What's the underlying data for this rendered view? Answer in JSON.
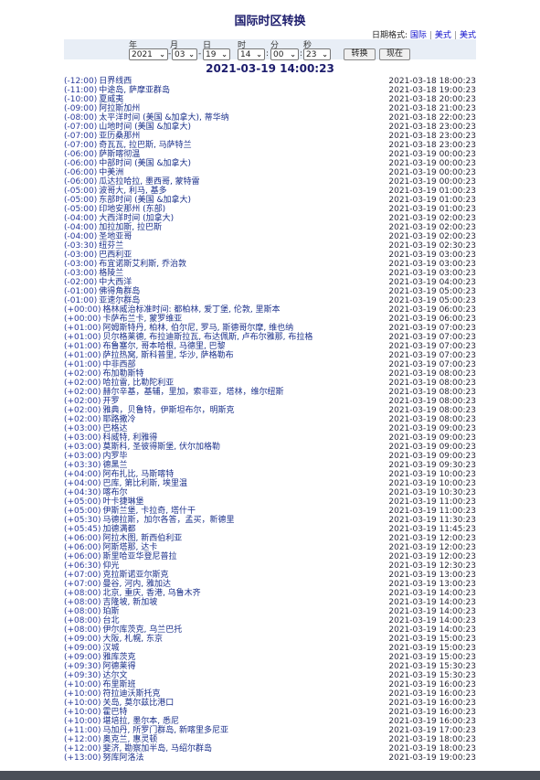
{
  "title": "国际时区转换",
  "date_format": {
    "label": "日期格式:",
    "options": [
      "国际",
      "美式",
      "美式"
    ]
  },
  "form": {
    "labels": {
      "year": "年",
      "month": "月",
      "day": "日",
      "hour": "时",
      "minute": "分",
      "second": "秒"
    },
    "values": {
      "year": "2021",
      "month": "03",
      "day": "19",
      "hour": "14",
      "minute": "00",
      "second": "23"
    },
    "date_sep": "-",
    "time_sep": ":",
    "convert_label": "转换",
    "now_label": "现在"
  },
  "current": "2021-03-19 14:00:23",
  "zones": [
    {
      "offset": "(-12:00)",
      "name": "日界线西",
      "time": "2021-03-18 18:00:23"
    },
    {
      "offset": "(-11:00)",
      "name": "中途岛, 萨摩亚群岛",
      "time": "2021-03-18 19:00:23"
    },
    {
      "offset": "(-10:00)",
      "name": "夏威夷",
      "time": "2021-03-18 20:00:23"
    },
    {
      "offset": "(-09:00)",
      "name": "阿拉斯加州",
      "time": "2021-03-18 21:00:23"
    },
    {
      "offset": "(-08:00)",
      "name": "太平洋时间 (美国 &加拿大), 蒂华纳",
      "time": "2021-03-18 22:00:23"
    },
    {
      "offset": "(-07:00)",
      "name": "山地时间 (美国 &加拿大)",
      "time": "2021-03-18 23:00:23"
    },
    {
      "offset": "(-07:00)",
      "name": "亚历桑那州",
      "time": "2021-03-18 23:00:23"
    },
    {
      "offset": "(-07:00)",
      "name": "奇瓦瓦, 拉巴斯, 马萨特兰",
      "time": "2021-03-18 23:00:23"
    },
    {
      "offset": "(-06:00)",
      "name": "萨斯喀彻温",
      "time": "2021-03-19 00:00:23"
    },
    {
      "offset": "(-06:00)",
      "name": "中部时间 (美国 &加拿大)",
      "time": "2021-03-19 00:00:23"
    },
    {
      "offset": "(-06:00)",
      "name": "中美洲",
      "time": "2021-03-19 00:00:23"
    },
    {
      "offset": "(-06:00)",
      "name": "瓜达拉哈拉, 墨西哥, 蒙特雷",
      "time": "2021-03-19 00:00:23"
    },
    {
      "offset": "(-05:00)",
      "name": "波哥大, 利马, 基多",
      "time": "2021-03-19 01:00:23"
    },
    {
      "offset": "(-05:00)",
      "name": "东部时间 (美国 &加拿大)",
      "time": "2021-03-19 01:00:23"
    },
    {
      "offset": "(-05:00)",
      "name": "印地安那州 (东部)",
      "time": "2021-03-19 01:00:23"
    },
    {
      "offset": "(-04:00)",
      "name": "大西洋时间 (加拿大)",
      "time": "2021-03-19 02:00:23"
    },
    {
      "offset": "(-04:00)",
      "name": "加拉加斯, 拉巴斯",
      "time": "2021-03-19 02:00:23"
    },
    {
      "offset": "(-04:00)",
      "name": "圣地亚哥",
      "time": "2021-03-19 02:00:23"
    },
    {
      "offset": "(-03:30)",
      "name": "纽芬兰",
      "time": "2021-03-19 02:30:23"
    },
    {
      "offset": "(-03:00)",
      "name": "巴西利亚",
      "time": "2021-03-19 03:00:23"
    },
    {
      "offset": "(-03:00)",
      "name": "布宜诺斯艾利斯, 乔治敦",
      "time": "2021-03-19 03:00:23"
    },
    {
      "offset": "(-03:00)",
      "name": "格陵兰",
      "time": "2021-03-19 03:00:23"
    },
    {
      "offset": "(-02:00)",
      "name": "中大西洋",
      "time": "2021-03-19 04:00:23"
    },
    {
      "offset": "(-01:00)",
      "name": "佛得角群岛",
      "time": "2021-03-19 05:00:23"
    },
    {
      "offset": "(-01:00)",
      "name": "亚速尔群岛",
      "time": "2021-03-19 05:00:23"
    },
    {
      "offset": "(+00:00)",
      "name": "格林威治标准时间: 都柏林, 爱丁堡, 伦敦, 里斯本",
      "time": "2021-03-19 06:00:23"
    },
    {
      "offset": "(+00:00)",
      "name": "卡萨布兰卡, 蒙罗维亚",
      "time": "2021-03-19 06:00:23"
    },
    {
      "offset": "(+01:00)",
      "name": "阿姆斯特丹, 柏林, 伯尔尼, 罗马, 斯德哥尔摩, 维也纳",
      "time": "2021-03-19 07:00:23"
    },
    {
      "offset": "(+01:00)",
      "name": "贝尔格莱德, 布拉迪斯拉瓦, 布达佩斯, 卢布尔雅那, 布拉格",
      "time": "2021-03-19 07:00:23"
    },
    {
      "offset": "(+01:00)",
      "name": "布鲁塞尔, 哥本哈根, 马德里, 巴黎",
      "time": "2021-03-19 07:00:23"
    },
    {
      "offset": "(+01:00)",
      "name": "萨拉热窝, 斯科普里, 华沙, 萨格勒布",
      "time": "2021-03-19 07:00:23"
    },
    {
      "offset": "(+01:00)",
      "name": "中非西部",
      "time": "2021-03-19 07:00:23"
    },
    {
      "offset": "(+02:00)",
      "name": "布加勒斯特",
      "time": "2021-03-19 08:00:23"
    },
    {
      "offset": "(+02:00)",
      "name": "哈拉雷, 比勒陀利亚",
      "time": "2021-03-19 08:00:23"
    },
    {
      "offset": "(+02:00)",
      "name": "赫尔辛基，基辅，里加，索非亚，塔林，维尔纽斯",
      "time": "2021-03-19 08:00:23"
    },
    {
      "offset": "(+02:00)",
      "name": "开罗",
      "time": "2021-03-19 08:00:23"
    },
    {
      "offset": "(+02:00)",
      "name": "雅典，贝鲁特，伊斯坦布尔，明斯克",
      "time": "2021-03-19 08:00:23"
    },
    {
      "offset": "(+02:00)",
      "name": "耶路撒冷",
      "time": "2021-03-19 08:00:23"
    },
    {
      "offset": "(+03:00)",
      "name": "巴格达",
      "time": "2021-03-19 09:00:23"
    },
    {
      "offset": "(+03:00)",
      "name": "科威特, 利雅得",
      "time": "2021-03-19 09:00:23"
    },
    {
      "offset": "(+03:00)",
      "name": "莫斯科, 圣彼得斯堡, 伏尔加格勒",
      "time": "2021-03-19 09:00:23"
    },
    {
      "offset": "(+03:00)",
      "name": "内罗毕",
      "time": "2021-03-19 09:00:23"
    },
    {
      "offset": "(+03:30)",
      "name": "德黑兰",
      "time": "2021-03-19 09:30:23"
    },
    {
      "offset": "(+04:00)",
      "name": "阿布扎比, 马斯喀特",
      "time": "2021-03-19 10:00:23"
    },
    {
      "offset": "(+04:00)",
      "name": "巴库, 第比利斯, 埃里温",
      "time": "2021-03-19 10:00:23"
    },
    {
      "offset": "(+04:30)",
      "name": "喀布尔",
      "time": "2021-03-19 10:30:23"
    },
    {
      "offset": "(+05:00)",
      "name": "叶卡捷琳堡",
      "time": "2021-03-19 11:00:23"
    },
    {
      "offset": "(+05:00)",
      "name": "伊斯兰堡, 卡拉奇, 塔什干",
      "time": "2021-03-19 11:00:23"
    },
    {
      "offset": "(+05:30)",
      "name": "马德拉斯，加尔各答，孟买，新德里",
      "time": "2021-03-19 11:30:23"
    },
    {
      "offset": "(+05:45)",
      "name": "加德满都",
      "time": "2021-03-19 11:45:23"
    },
    {
      "offset": "(+06:00)",
      "name": "阿拉木图, 新西伯利亚",
      "time": "2021-03-19 12:00:23"
    },
    {
      "offset": "(+06:00)",
      "name": "阿斯塔那, 达卡",
      "time": "2021-03-19 12:00:23"
    },
    {
      "offset": "(+06:00)",
      "name": "斯里哈亚华登尼普拉",
      "time": "2021-03-19 12:00:23"
    },
    {
      "offset": "(+06:30)",
      "name": "仰光",
      "time": "2021-03-19 12:30:23"
    },
    {
      "offset": "(+07:00)",
      "name": "克拉斯诺亚尔斯克",
      "time": "2021-03-19 13:00:23"
    },
    {
      "offset": "(+07:00)",
      "name": "曼谷, 河内, 雅加达",
      "time": "2021-03-19 13:00:23"
    },
    {
      "offset": "(+08:00)",
      "name": "北京, 重庆, 香港, 乌鲁木齐",
      "time": "2021-03-19 14:00:23"
    },
    {
      "offset": "(+08:00)",
      "name": "吉隆坡, 新加坡",
      "time": "2021-03-19 14:00:23"
    },
    {
      "offset": "(+08:00)",
      "name": "珀斯",
      "time": "2021-03-19 14:00:23"
    },
    {
      "offset": "(+08:00)",
      "name": "台北",
      "time": "2021-03-19 14:00:23"
    },
    {
      "offset": "(+08:00)",
      "name": "伊尔库茨克, 乌兰巴托",
      "time": "2021-03-19 14:00:23"
    },
    {
      "offset": "(+09:00)",
      "name": "大阪, 札幌, 东京",
      "time": "2021-03-19 15:00:23"
    },
    {
      "offset": "(+09:00)",
      "name": "汉城",
      "time": "2021-03-19 15:00:23"
    },
    {
      "offset": "(+09:00)",
      "name": "雅库茨克",
      "time": "2021-03-19 15:00:23"
    },
    {
      "offset": "(+09:30)",
      "name": "阿德莱得",
      "time": "2021-03-19 15:30:23"
    },
    {
      "offset": "(+09:30)",
      "name": "达尔文",
      "time": "2021-03-19 15:30:23"
    },
    {
      "offset": "(+10:00)",
      "name": "布里斯班",
      "time": "2021-03-19 16:00:23"
    },
    {
      "offset": "(+10:00)",
      "name": "符拉迪沃斯托克",
      "time": "2021-03-19 16:00:23"
    },
    {
      "offset": "(+10:00)",
      "name": "关岛, 莫尔兹比港口",
      "time": "2021-03-19 16:00:23"
    },
    {
      "offset": "(+10:00)",
      "name": "霍巴特",
      "time": "2021-03-19 16:00:23"
    },
    {
      "offset": "(+10:00)",
      "name": "堪培拉, 墨尔本, 悉尼",
      "time": "2021-03-19 16:00:23"
    },
    {
      "offset": "(+11:00)",
      "name": "马加丹, 所罗门群岛, 新喀里多尼亚",
      "time": "2021-03-19 17:00:23"
    },
    {
      "offset": "(+12:00)",
      "name": "奥克兰, 惠灵顿",
      "time": "2021-03-19 18:00:23"
    },
    {
      "offset": "(+12:00)",
      "name": "斐济, 勘察加半岛, 马绍尔群岛",
      "time": "2021-03-19 18:00:23"
    },
    {
      "offset": "(+13:00)",
      "name": "努库阿洛法",
      "time": "2021-03-19 19:00:23"
    }
  ],
  "colors": {
    "title": "#1c1c6c",
    "link": "#1010cc",
    "form_bg": "#e8eef6",
    "footer": "#4a4f58"
  }
}
